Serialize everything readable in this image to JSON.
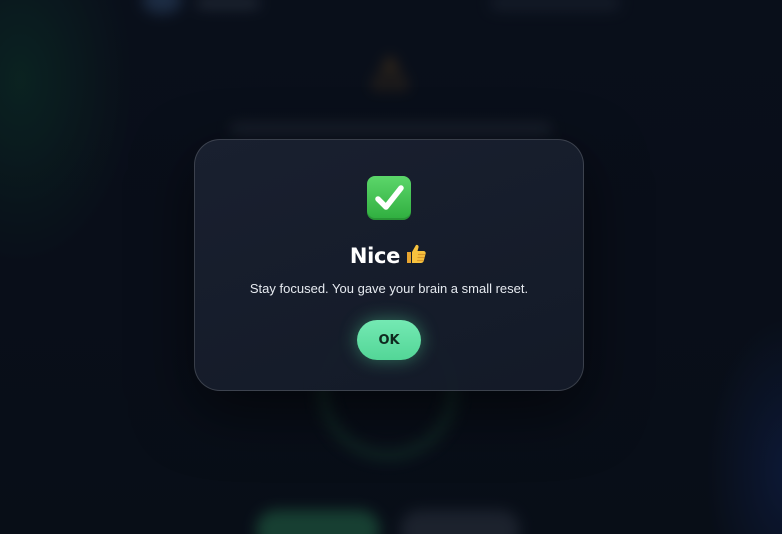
{
  "modal": {
    "icon": "check-mark-button-icon",
    "title": "Nice",
    "title_icon": "thumbs-up-icon",
    "message": "Stay focused. You gave your brain a small reset.",
    "ok_label": "OK"
  },
  "colors": {
    "accent": "#5cdca0",
    "check_green": "#3cbf4b",
    "warning_orange": "#e8962a",
    "background": "#0b1220"
  }
}
